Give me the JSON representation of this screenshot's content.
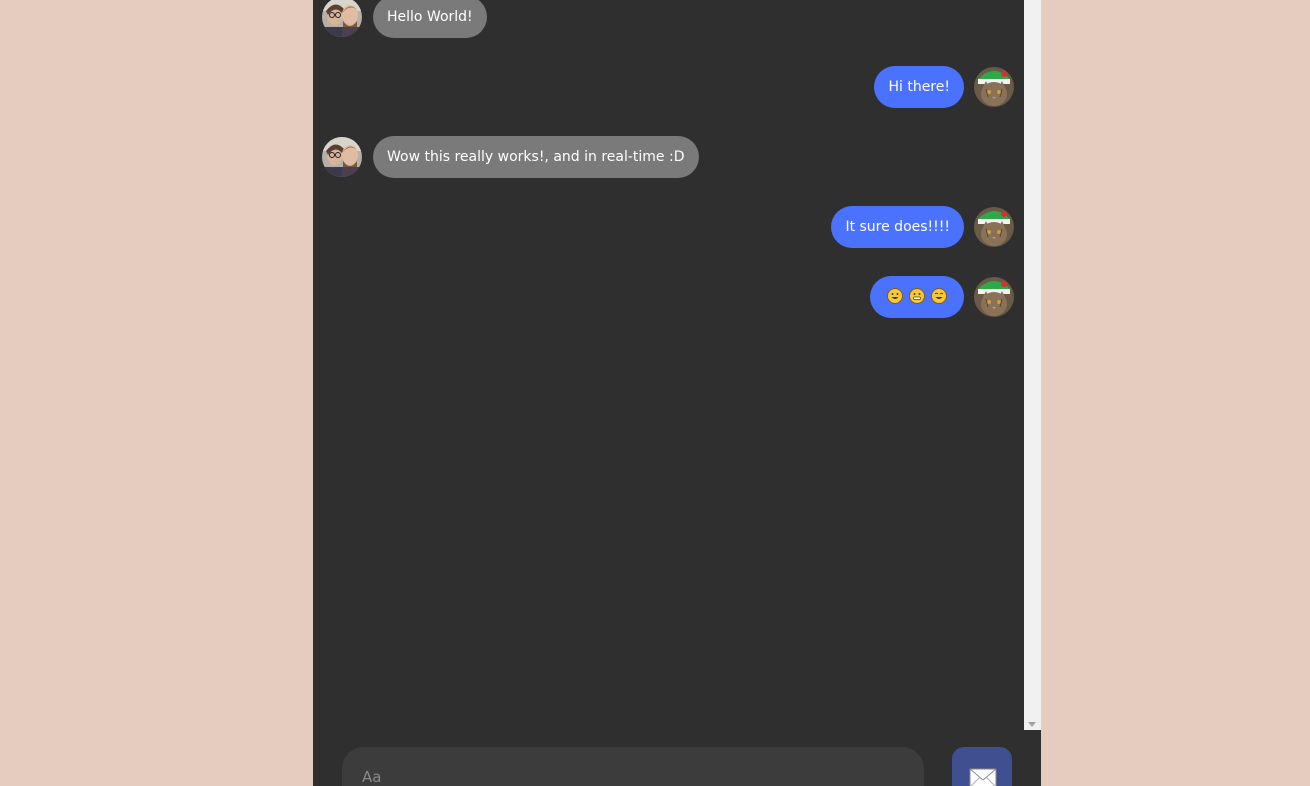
{
  "messages": [
    {
      "direction": "incoming",
      "text": "Hello World!",
      "avatar": "couple-avatar"
    },
    {
      "direction": "outgoing",
      "text": "Hi there!",
      "avatar": "cat-avatar"
    },
    {
      "direction": "incoming",
      "text": "Wow this really works!, and in real-time :D",
      "avatar": "couple-avatar"
    },
    {
      "direction": "outgoing",
      "text": "It sure does!!!!",
      "avatar": "cat-avatar"
    },
    {
      "direction": "outgoing",
      "text": "",
      "emojis": [
        "grinning-face-emoji",
        "grimacing-face-emoji",
        "grinning-smile-emoji"
      ],
      "avatar": "cat-avatar"
    }
  ],
  "composer": {
    "placeholder": "Aa",
    "send_icon": "envelope-icon"
  },
  "colors": {
    "page_background": "#e6cbbf",
    "chat_background": "#2f2f2f",
    "incoming_bubble": "#7a7a7a",
    "outgoing_bubble": "#4a72ff",
    "send_button": "#3f4f8f"
  }
}
